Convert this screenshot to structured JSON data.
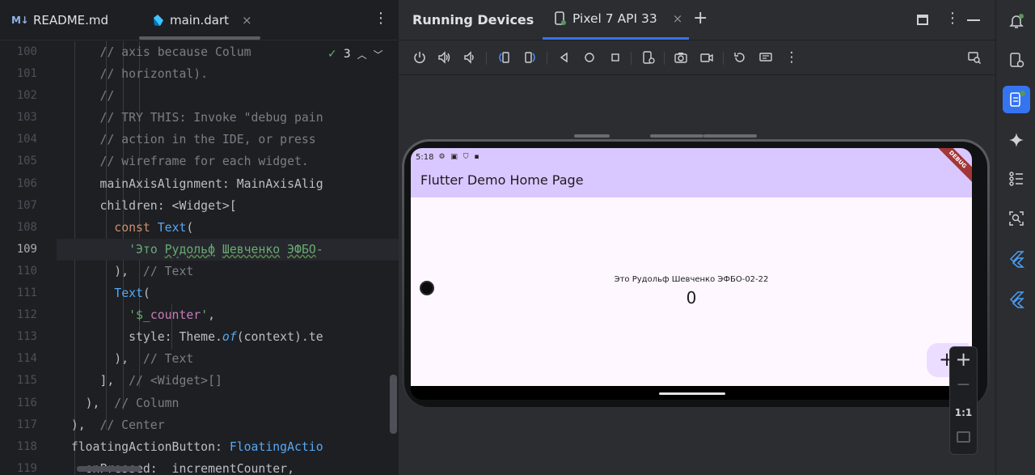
{
  "editor": {
    "tabs": [
      {
        "icon": "markdown-icon",
        "label": "README.md"
      },
      {
        "icon": "dart-icon",
        "label": "main.dart",
        "close": "×"
      }
    ],
    "kebab": "⋮",
    "fold_widget": {
      "check": "✓",
      "count": "3"
    },
    "current_line": 109,
    "line_numbers": [
      "100",
      "101",
      "102",
      "103",
      "104",
      "105",
      "106",
      "107",
      "108",
      "109",
      "110",
      "111",
      "112",
      "113",
      "114",
      "115",
      "116",
      "117",
      "118",
      "119"
    ]
  },
  "running_devices": {
    "title": "Running Devices",
    "device_tab": "Pixel 7 API 33",
    "tab_close": "×",
    "add_tab": "+",
    "kebab": "⋮",
    "toolbar": [
      "power-icon",
      "volume-up-icon",
      "volume-down-icon",
      "rotate-left-icon",
      "rotate-right-icon",
      "back-icon",
      "home-icon",
      "overview-icon",
      "device-settings-icon",
      "screenshot-icon",
      "screen-record-icon",
      "reset-icon",
      "mirror-icon",
      "more-icon",
      "find-icon"
    ]
  },
  "emulator": {
    "status_time": "5:18",
    "status_icons": "⚙ ▣ ⛉ ▪",
    "app_title": "Flutter Demo Home Page",
    "debug_banner": "DEBUG",
    "message": "Это Рудольф Шевченко ЭФБО-02-22",
    "counter": "0",
    "fab_label": "+",
    "zoom": {
      "plus": "+",
      "minus": "−",
      "actual": "1:1"
    }
  },
  "tool_strip": [
    "notifications-icon",
    "device-manager-icon",
    "running-devices-icon",
    "gemini-icon",
    "structure-icon",
    "layout-inspector-icon",
    "flutter-inspector-icon",
    "flutter-performance-icon"
  ],
  "colors": {
    "accent": "#3574f0",
    "app_bar": "#d9c7ff",
    "app_body": "#fef7ff"
  }
}
